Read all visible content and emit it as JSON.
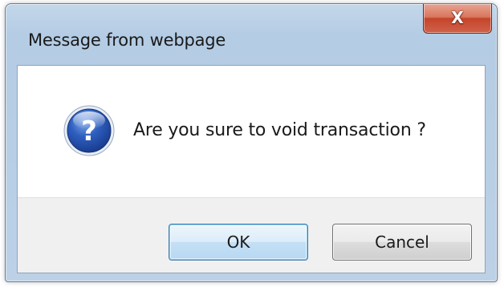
{
  "dialog": {
    "title": "Message from webpage",
    "close_glyph": "X",
    "message": "Are you sure to void transaction ?",
    "icon": "question-icon",
    "buttons": {
      "ok_label": "OK",
      "cancel_label": "Cancel"
    }
  },
  "colors": {
    "frame": "#bcd1e6",
    "close_button": "#c4452a",
    "ok_border": "#3c7fb1",
    "icon_blue": "#1f4fa8"
  }
}
